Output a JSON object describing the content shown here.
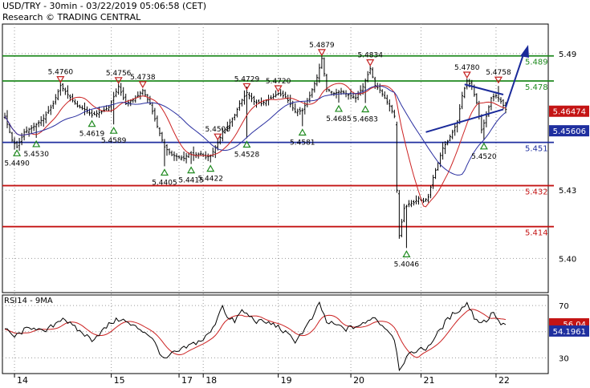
{
  "header": {
    "title": "USD/TRY - 30min - 03/22/2019 05:06:58 (CET)",
    "credit": "Research © TRADING CENTRAL"
  },
  "colors": {
    "candle": "#000000",
    "support": "#1f2f9f",
    "resistance_green": "#1f8a1f",
    "resistance_red": "#c41414",
    "ma_red": "#cc2222",
    "ma_blue": "#2a2fa0",
    "grid": "#9a9a9a",
    "current_price_bg": "#0d1e7a",
    "arrow": "#1a2a9a",
    "pivot_high": "#c42020",
    "pivot_low": "#1f8a1f"
  },
  "chart_data": [
    {
      "type": "candlestick",
      "title": "USD/TRY - 30min",
      "ylim": [
        5.385,
        5.503
      ],
      "x_labels": [
        "14",
        "15",
        "17",
        "18",
        "19",
        "20",
        "21",
        "22"
      ],
      "y_ticks": [
        "5.49",
        "5.43",
        "5.40"
      ],
      "price_path": [
        [
          0,
          5.4625
        ],
        [
          3,
          5.452
        ],
        [
          5,
          5.449
        ],
        [
          8,
          5.4555
        ],
        [
          12,
          5.458
        ],
        [
          16,
          5.4615
        ],
        [
          20,
          5.468
        ],
        [
          23,
          5.476
        ],
        [
          26,
          5.472
        ],
        [
          30,
          5.467
        ],
        [
          33,
          5.4655
        ],
        [
          36,
          5.463
        ],
        [
          40,
          5.4645
        ],
        [
          43,
          5.4665
        ],
        [
          47,
          5.4756
        ],
        [
          50,
          5.468
        ],
        [
          54,
          5.4705
        ],
        [
          57,
          5.4738
        ],
        [
          60,
          5.468
        ],
        [
          63,
          5.458
        ],
        [
          66,
          5.449
        ],
        [
          69,
          5.4455
        ],
        [
          72,
          5.4445
        ],
        [
          74,
          5.444
        ],
        [
          76,
          5.446
        ],
        [
          78,
          5.4455
        ],
        [
          81,
          5.446
        ],
        [
          83,
          5.4445
        ],
        [
          85,
          5.445
        ],
        [
          88,
          5.4508
        ],
        [
          90,
          5.4555
        ],
        [
          92,
          5.458
        ],
        [
          95,
          5.463
        ],
        [
          97,
          5.468
        ],
        [
          100,
          5.4729
        ],
        [
          103,
          5.469
        ],
        [
          106,
          5.468
        ],
        [
          110,
          5.4705
        ],
        [
          113,
          5.4725
        ],
        [
          116,
          5.471
        ],
        [
          120,
          5.4645
        ],
        [
          123,
          5.465
        ],
        [
          126,
          5.4715
        ],
        [
          129,
          5.4795
        ],
        [
          131,
          5.4879
        ],
        [
          133,
          5.4745
        ],
        [
          136,
          5.4725
        ],
        [
          139,
          5.4735
        ],
        [
          142,
          5.472
        ],
        [
          145,
          5.4705
        ],
        [
          148,
          5.4755
        ],
        [
          151,
          5.4834
        ],
        [
          153,
          5.476
        ],
        [
          155,
          5.474
        ],
        [
          157,
          5.4705
        ],
        [
          159,
          5.467
        ],
        [
          161,
          5.4625
        ],
        [
          162,
          5.43
        ],
        [
          163,
          5.41
        ],
        [
          165,
          5.422
        ],
        [
          167,
          5.424
        ],
        [
          169,
          5.4245
        ],
        [
          171,
          5.4265
        ],
        [
          173,
          5.425
        ],
        [
          175,
          5.427
        ],
        [
          177,
          5.4355
        ],
        [
          179,
          5.442
        ],
        [
          181,
          5.4485
        ],
        [
          183,
          5.4515
        ],
        [
          185,
          5.4555
        ],
        [
          187,
          5.46
        ],
        [
          189,
          5.4715
        ],
        [
          191,
          5.478
        ],
        [
          193,
          5.4755
        ],
        [
          195,
          5.4685
        ],
        [
          197,
          5.4565
        ],
        [
          199,
          5.4625
        ],
        [
          201,
          5.4705
        ],
        [
          203,
          5.4715
        ],
        [
          205,
          5.469
        ],
        [
          207,
          5.4655
        ]
      ],
      "horizontal_levels": [
        {
          "value": 5.489,
          "label": "5.489",
          "color": "#1f8a1f"
        },
        {
          "value": 5.478,
          "label": "5.478",
          "color": "#1f8a1f"
        },
        {
          "value": 5.451,
          "label": "5.451",
          "color": "#1f2f9f"
        },
        {
          "value": 5.432,
          "label": "5.432",
          "color": "#c41414"
        },
        {
          "value": 5.414,
          "label": "5.414",
          "color": "#c41414"
        }
      ],
      "current_price": "5.4655",
      "price_tags": [
        "5.46474",
        "5.45606"
      ],
      "pivot_highs": [
        {
          "bar": 23,
          "label": "5.4760"
        },
        {
          "bar": 47,
          "label": "5.4756"
        },
        {
          "bar": 57,
          "label": "5.4738"
        },
        {
          "bar": 88,
          "label": "5.4508"
        },
        {
          "bar": 100,
          "label": "5.4729"
        },
        {
          "bar": 113,
          "label": "5.4720"
        },
        {
          "bar": 131,
          "label": "5.4879"
        },
        {
          "bar": 151,
          "label": "5.4834"
        },
        {
          "bar": 191,
          "label": "5.4780"
        },
        {
          "bar": 204,
          "label": "5.4758"
        }
      ],
      "pivot_lows": [
        {
          "bar": 5,
          "label": "5.4490"
        },
        {
          "bar": 13,
          "label": "5.4530"
        },
        {
          "bar": 36,
          "label": "5.4619"
        },
        {
          "bar": 45,
          "label": "5.4589"
        },
        {
          "bar": 66,
          "label": "5.4405"
        },
        {
          "bar": 77,
          "label": "5.4415"
        },
        {
          "bar": 85,
          "label": "5.4422"
        },
        {
          "bar": 100,
          "label": "5.4528"
        },
        {
          "bar": 123,
          "label": "5.4581"
        },
        {
          "bar": 138,
          "label": "5.4685"
        },
        {
          "bar": 149,
          "label": "5.4683"
        },
        {
          "bar": 166,
          "label": "5.4046"
        },
        {
          "bar": 198,
          "label": "5.4520"
        }
      ]
    },
    {
      "type": "line",
      "title": "RSI14 - 9MA",
      "ylim": [
        18,
        78
      ],
      "y_ticks": [
        "70",
        "50",
        "30"
      ],
      "rsi_path": [
        [
          0,
          52
        ],
        [
          4,
          46
        ],
        [
          8,
          51
        ],
        [
          12,
          54
        ],
        [
          16,
          49
        ],
        [
          20,
          55
        ],
        [
          24,
          61
        ],
        [
          28,
          54
        ],
        [
          32,
          49
        ],
        [
          36,
          44
        ],
        [
          40,
          50
        ],
        [
          44,
          57
        ],
        [
          48,
          60
        ],
        [
          52,
          55
        ],
        [
          56,
          52
        ],
        [
          60,
          47
        ],
        [
          63,
          38
        ],
        [
          66,
          28
        ],
        [
          69,
          33
        ],
        [
          72,
          35
        ],
        [
          75,
          38
        ],
        [
          78,
          41
        ],
        [
          82,
          44
        ],
        [
          86,
          52
        ],
        [
          88,
          62
        ],
        [
          90,
          71
        ],
        [
          92,
          60
        ],
        [
          95,
          58
        ],
        [
          98,
          66
        ],
        [
          101,
          62
        ],
        [
          104,
          58
        ],
        [
          108,
          57
        ],
        [
          112,
          55
        ],
        [
          116,
          49
        ],
        [
          120,
          43
        ],
        [
          124,
          52
        ],
        [
          128,
          63
        ],
        [
          130,
          72
        ],
        [
          133,
          57
        ],
        [
          137,
          55
        ],
        [
          141,
          52
        ],
        [
          145,
          54
        ],
        [
          149,
          56
        ],
        [
          152,
          62
        ],
        [
          156,
          55
        ],
        [
          159,
          50
        ],
        [
          161,
          45
        ],
        [
          163,
          22
        ],
        [
          166,
          30
        ],
        [
          170,
          36
        ],
        [
          174,
          37
        ],
        [
          178,
          46
        ],
        [
          182,
          57
        ],
        [
          186,
          65
        ],
        [
          189,
          68
        ],
        [
          191,
          72
        ],
        [
          194,
          61
        ],
        [
          197,
          57
        ],
        [
          200,
          60
        ],
        [
          202,
          66
        ],
        [
          204,
          57
        ],
        [
          207,
          55
        ]
      ],
      "ma_values": [
        "56.04",
        "54.1961"
      ]
    }
  ]
}
